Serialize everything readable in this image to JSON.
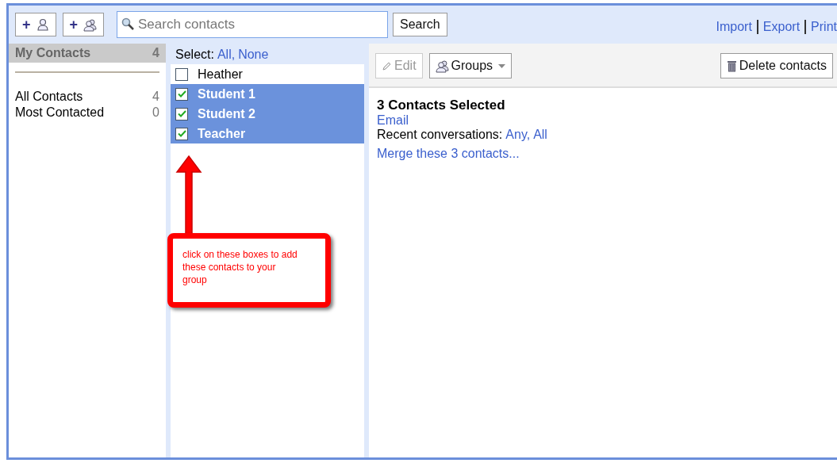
{
  "toolbar": {
    "add_buttons": [
      {
        "label": "+",
        "kind": "contact"
      },
      {
        "label": "+",
        "kind": "group"
      }
    ],
    "search": {
      "placeholder": "Search contacts"
    },
    "search_button": "Search",
    "links": [
      "Import",
      "Export",
      "Print"
    ]
  },
  "sidebar": {
    "header": {
      "label": "My Contacts",
      "count": "4",
      "selected": true
    },
    "items": [
      {
        "label": "All Contacts",
        "count": "4",
        "selected": false
      },
      {
        "label": "Most Contacted",
        "count": "0",
        "selected": false
      }
    ]
  },
  "contact_list": {
    "select_label": "Select:",
    "select_links": [
      "All,",
      "None"
    ],
    "contacts": [
      {
        "name": "Heather",
        "checked": false,
        "selected": false
      },
      {
        "name": "Student 1",
        "checked": true,
        "selected": true
      },
      {
        "name": "Student 2",
        "checked": true,
        "selected": true
      },
      {
        "name": "Teacher",
        "checked": true,
        "selected": true
      }
    ]
  },
  "detail": {
    "buttons": [
      {
        "label": "Edit",
        "kind": "edit",
        "disabled": true
      },
      {
        "label": "Groups",
        "kind": "groups",
        "disabled": false
      },
      {
        "label": "Delete contacts",
        "kind": "delete",
        "disabled": false
      }
    ],
    "title": "3 Contacts Selected",
    "email_link": "Email",
    "recent_label": "Recent conversations:",
    "recent_links": [
      "Any,",
      "All"
    ],
    "merge_link": "Merge these 3 contacts..."
  },
  "annotation": {
    "text": "click on these boxes to add these contacts to your group"
  }
}
